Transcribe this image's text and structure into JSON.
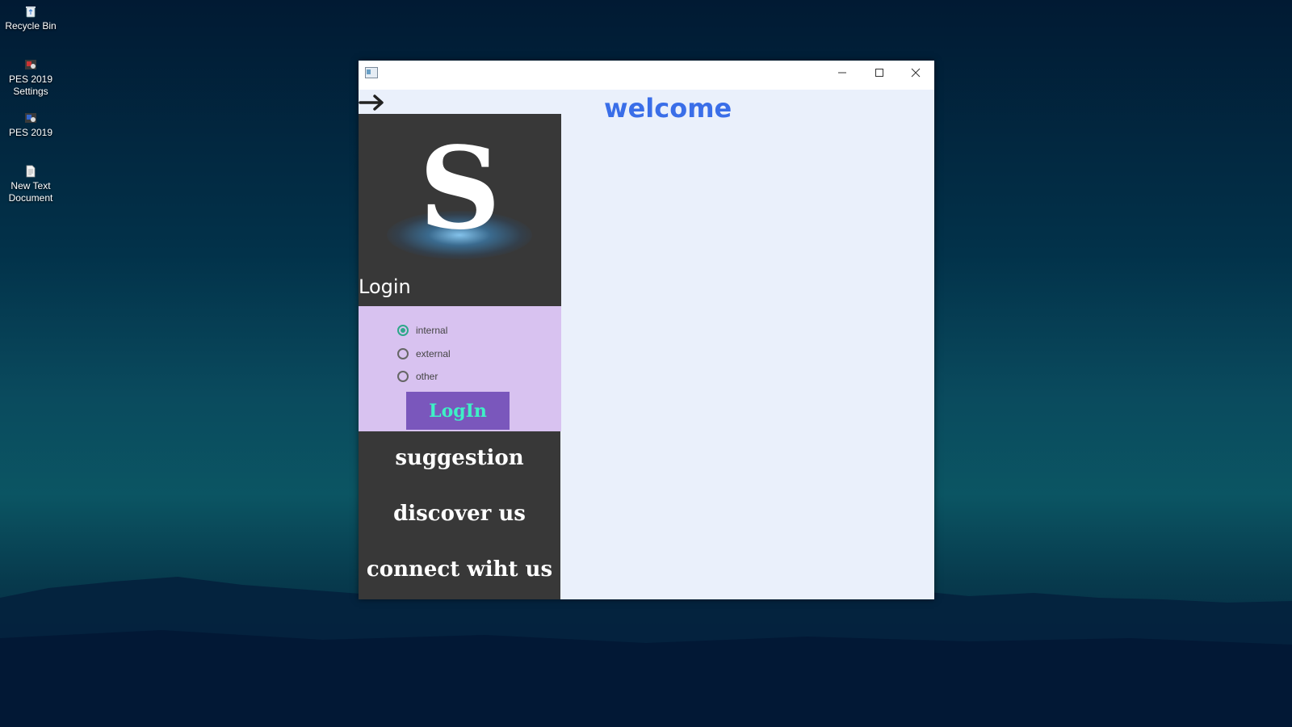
{
  "desktop": {
    "icons": [
      {
        "label": "Recycle Bin",
        "icon": "recycle-bin-icon"
      },
      {
        "label": "PES 2019 Settings",
        "icon": "game-settings-icon"
      },
      {
        "label": "PES 2019",
        "icon": "game-icon"
      },
      {
        "label": "New Text Document",
        "icon": "text-document-icon"
      }
    ]
  },
  "window": {
    "controls": {
      "minimize": "minimize-icon",
      "maximize": "maximize-icon",
      "close": "close-icon"
    }
  },
  "sidebar": {
    "back_icon": "arrow-right-icon",
    "logo_letter": "S",
    "login_title": "Login",
    "login_options": [
      {
        "label": "internal",
        "checked": true
      },
      {
        "label": "external",
        "checked": false
      },
      {
        "label": "other",
        "checked": false
      }
    ],
    "login_button": "LogIn",
    "menu": [
      {
        "label": "suggestion"
      },
      {
        "label": "discover us"
      },
      {
        "label": "connect wiht us"
      }
    ]
  },
  "main": {
    "welcome": "welcome"
  },
  "colors": {
    "accent": "#3a6ee8",
    "login_panel": "#d8c2f0",
    "login_button_bg": "#7a57bc",
    "login_button_text": "#3ef0c6",
    "dark_panel": "#383838",
    "radio_checked": "#2ea88a"
  }
}
